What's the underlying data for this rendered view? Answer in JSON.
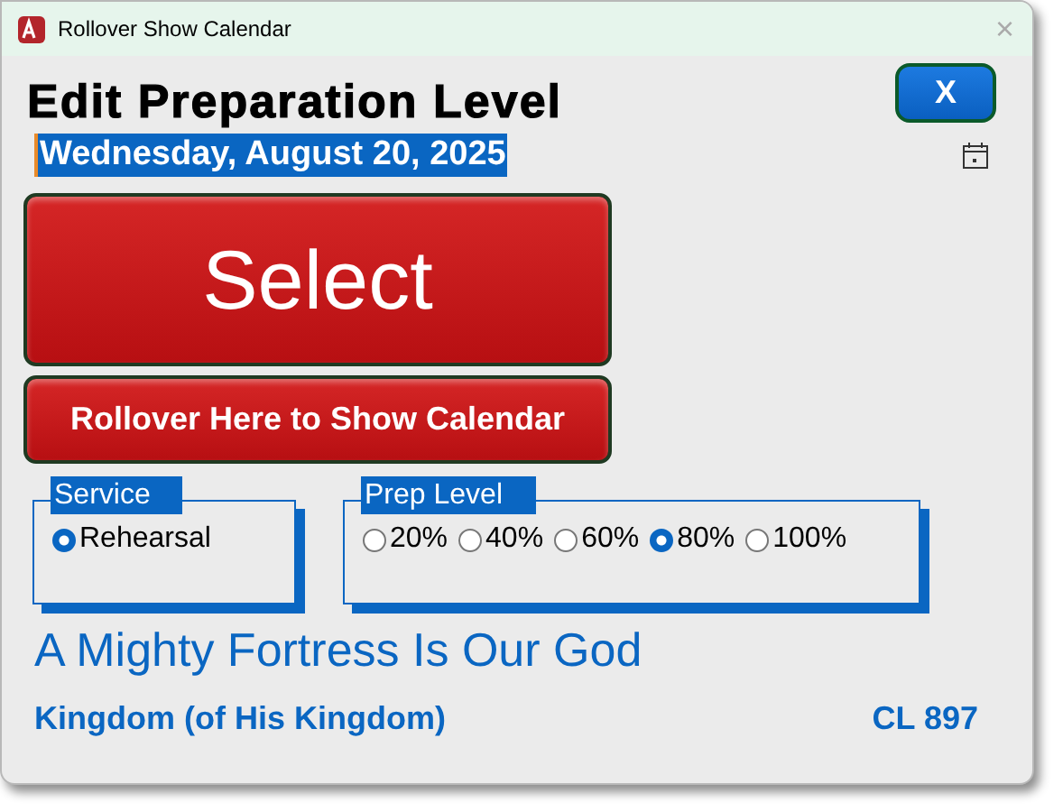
{
  "window": {
    "title": "Rollover Show Calendar",
    "close": "×"
  },
  "heading": "Edit Preparation Level",
  "close_button": "X",
  "date": "Wednesday, August 20, 2025",
  "select_button": "Select",
  "calendar_button": "Rollover Here to Show Calendar",
  "service": {
    "title": "Service",
    "options": [
      {
        "label": "Rehearsal",
        "selected": true
      }
    ]
  },
  "prep_level": {
    "title": "Prep Level",
    "options": [
      {
        "label": "20%",
        "selected": false
      },
      {
        "label": "40%",
        "selected": false
      },
      {
        "label": "60%",
        "selected": false
      },
      {
        "label": "80%",
        "selected": true
      },
      {
        "label": "100%",
        "selected": false
      }
    ]
  },
  "song_title": "A Mighty Fortress Is Our God",
  "tune": "Kingdom (of His Kingdom)",
  "hymn_number": "CL 897"
}
